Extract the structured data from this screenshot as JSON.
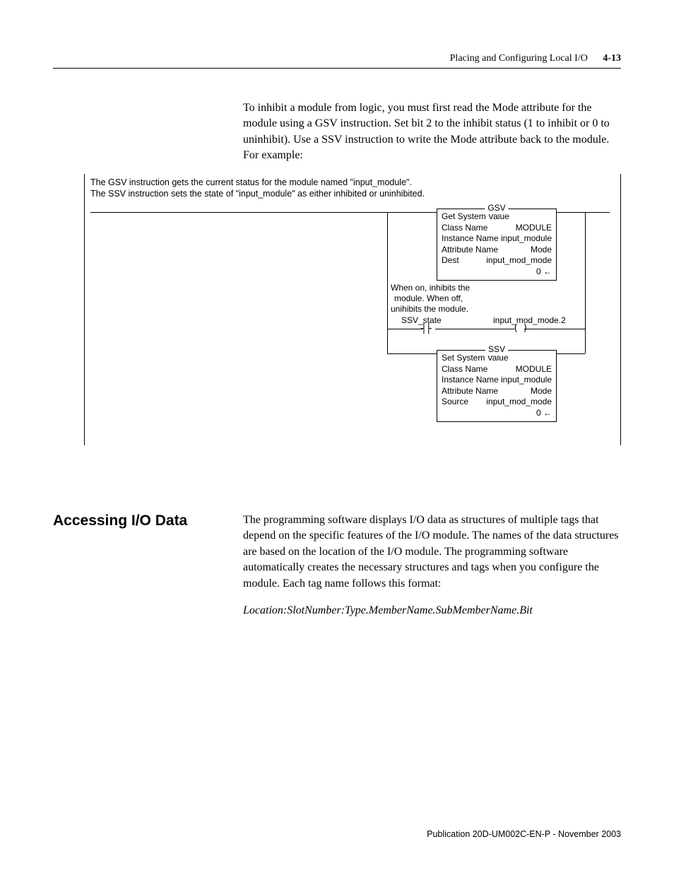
{
  "header": {
    "title": "Placing and Configuring Local I/O",
    "page_number": "4-13"
  },
  "intro_paragraph": "To inhibit a module from logic, you must first read the Mode attribute for the module using a GSV instruction.   Set bit 2 to the inhibit status (1 to inhibit or 0 to uninhibit). Use a SSV instruction to write the Mode attribute back to the module. For example:",
  "diagram": {
    "description_line1": "The GSV instruction gets the current status for the module named \"input_module\".",
    "description_line2": "The SSV instruction sets the state of \"input_module\" as either inhibited or uninhibited.",
    "gsv": {
      "label": "GSV",
      "title": "Get System Value",
      "class_name_label": "Class Name",
      "class_name_value": "MODULE",
      "instance_name_label": "Instance Name",
      "instance_name_value": "input_module",
      "attribute_name_label": "Attribute Name",
      "attribute_name_value": "Mode",
      "dest_label": "Dest",
      "dest_value": "input_mod_mode",
      "result": "0"
    },
    "branch_desc": {
      "line1": "When on, inhibits the",
      "line2": "module. When off,",
      "line3": "unihibits the module."
    },
    "contact": {
      "name": "SSV_state"
    },
    "coil": {
      "name": "input_mod_mode.2"
    },
    "ssv": {
      "label": "SSV",
      "title": "Set System Value",
      "class_name_label": "Class Name",
      "class_name_value": "MODULE",
      "instance_name_label": "Instance Name",
      "instance_name_value": "input_module",
      "attribute_name_label": "Attribute Name",
      "attribute_name_value": "Mode",
      "source_label": "Source",
      "source_value": "input_mod_mode",
      "result": "0"
    }
  },
  "section": {
    "heading": "Accessing I/O Data",
    "body_paragraph": "The programming software displays I/O data as structures of multiple tags that depend on the specific features of the I/O module. The names of the data structures are based on the location of the I/O module. The programming software automatically creates the necessary structures and tags when you configure the module. Each tag name follows this format:",
    "tag_format": "Location:SlotNumber:Type.MemberName.SubMemberName.Bit"
  },
  "footer": "Publication 20D-UM002C-EN-P - November 2003"
}
